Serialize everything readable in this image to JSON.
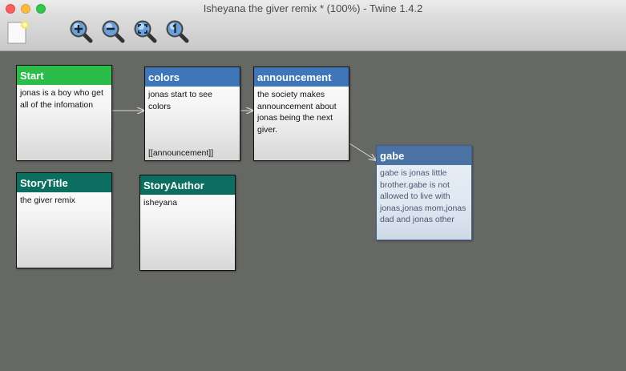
{
  "window": {
    "title": "Isheyana the giver remix * (100%) - Twine 1.4.2"
  },
  "toolbar": {
    "buttons": [
      {
        "name": "new-passage-button",
        "icon": "new-passage-icon"
      },
      {
        "name": "zoom-in-button",
        "icon": "zoom-in-icon"
      },
      {
        "name": "zoom-out-button",
        "icon": "zoom-out-icon"
      },
      {
        "name": "zoom-fit-button",
        "icon": "zoom-fit-icon"
      },
      {
        "name": "zoom-actual-button",
        "icon": "zoom-actual-icon"
      }
    ]
  },
  "colors": {
    "start_header": "#2bbc4a",
    "passage_header": "#3e76b8",
    "special_header": "#0b6e60",
    "selected_header": "#4a73a3",
    "canvas": "#666864",
    "link": "#d8d8d8"
  },
  "passages": {
    "start": {
      "title": "Start",
      "body": "jonas is a boy who get all of the infomation"
    },
    "colors": {
      "title": "colors",
      "body": "jonas start to see colors\n\n\n\n[[announcement]]"
    },
    "announcement": {
      "title": "announcement",
      "body": "the society makes announcement about jonas being the next giver."
    },
    "gabe": {
      "title": "gabe",
      "body": "gabe is jonas little brother.gabe is not allowed to live with jonas,jonas mom,jonas dad and jonas other"
    },
    "storytitle": {
      "title": "StoryTitle",
      "body": "the giver remix"
    },
    "storyauthor": {
      "title": "StoryAuthor",
      "body": "isheyana"
    }
  }
}
